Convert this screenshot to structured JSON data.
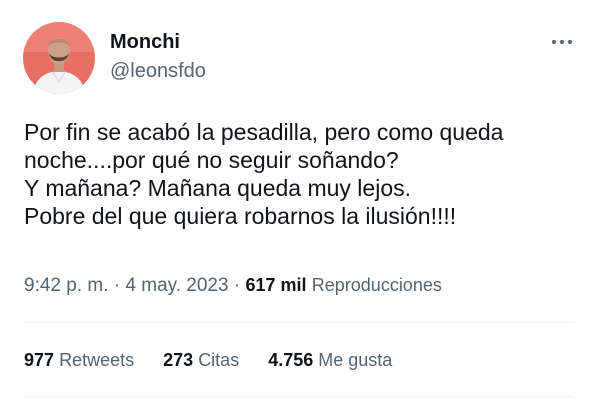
{
  "author": {
    "display_name": "Monchi",
    "handle": "@leonsfdo"
  },
  "tweet": {
    "lines": [
      "Por fin se acabó la pesadilla, pero como queda",
      "noche....por qué no seguir soñando?",
      "Y mañana? Mañana queda muy lejos.",
      "Pobre del que quiera robarnos la ilusión!!!!"
    ]
  },
  "meta": {
    "time": "9:42 p. m.",
    "sep1": "·",
    "date": "4 may. 2023",
    "sep2": "·",
    "views_count": "617 mil",
    "views_label": "Reproducciones"
  },
  "stats": {
    "retweets_count": "977",
    "retweets_label": "Retweets",
    "quotes_count": "273",
    "quotes_label": "Citas",
    "likes_count": "4.756",
    "likes_label": "Me gusta"
  },
  "icons": {
    "more": "more-options-icon"
  },
  "colors": {
    "text_primary": "#0f1419",
    "text_secondary": "#536471",
    "divider": "#eff3f4",
    "avatar_background": "#e76f63"
  }
}
